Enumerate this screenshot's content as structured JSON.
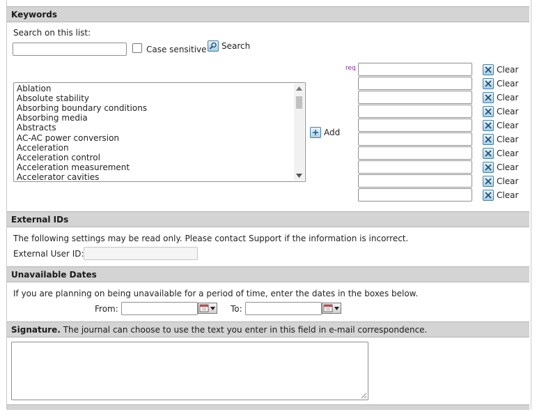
{
  "keywords": {
    "header": "Keywords",
    "search_label": "Search on this list:",
    "search_value": "",
    "case_sensitive_label": "Case sensitive",
    "search_button_label": "Search",
    "add_button_label": "Add",
    "req_label": "req",
    "list_items": [
      "Ablation",
      "Absolute stability",
      "Absorbing boundary conditions",
      "Absorbing media",
      "Abstracts",
      "AC-AC power conversion",
      "Acceleration",
      "Acceleration control",
      "Acceleration measurement",
      "Accelerator cavities"
    ],
    "selected_fields": [
      "",
      "",
      "",
      "",
      "",
      "",
      "",
      "",
      "",
      ""
    ],
    "clear_label": "Clear"
  },
  "external_ids": {
    "header": "External IDs",
    "note": "The following settings may be read only. Please contact Support if the information is incorrect.",
    "user_id_label": "External User ID:",
    "user_id_value": ""
  },
  "unavailable_dates": {
    "header": "Unavailable Dates",
    "note": "If you are planning on being unavailable for a period of time, enter the dates in the boxes below.",
    "from_label": "From:",
    "from_value": "",
    "to_label": "To:",
    "to_value": ""
  },
  "signature": {
    "header_bold": "Signature.",
    "header_rest": " The journal can choose to use the text you enter in this field in e-mail correspondence.",
    "value": ""
  },
  "colors": {
    "section_header_bg": "#d4d4d4",
    "req_color": "#7a2b8a",
    "icon_accent": "#4a7fa3"
  }
}
